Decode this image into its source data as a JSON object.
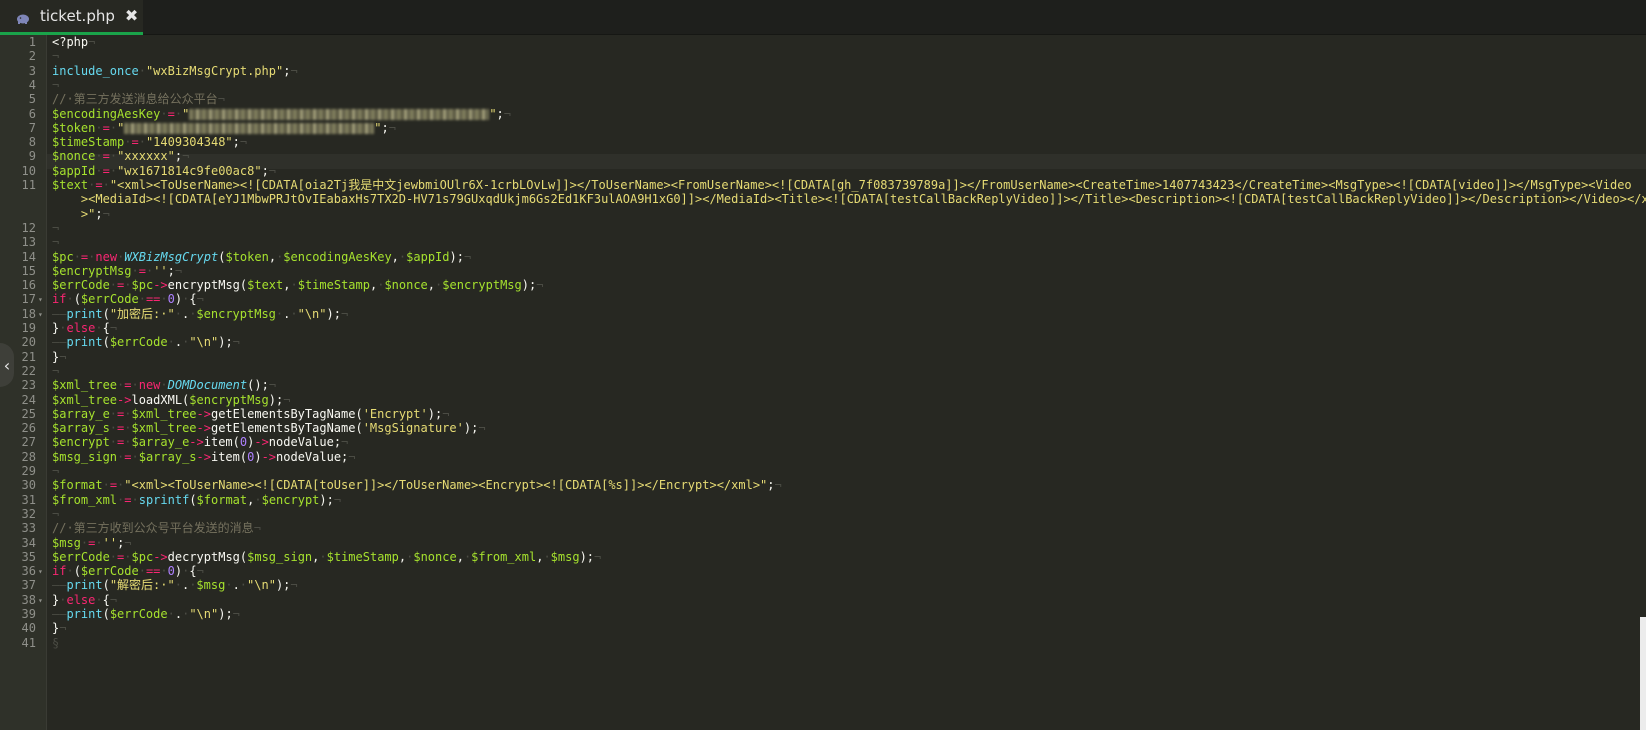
{
  "tab": {
    "title": "ticket.php",
    "close_glyph": "✖",
    "icon": "php-elephant-icon"
  },
  "handle": {
    "glyph": "‹"
  },
  "colors": {
    "background": "#272822",
    "gutter": "#2f3129",
    "variable": "#a6e22e",
    "string": "#e6db74",
    "comment": "#75715e",
    "keyword": "#f92672",
    "class": "#66d9ef",
    "number": "#ae81ff",
    "tab_accent": "#1aa34a"
  },
  "fold_lines": [
    17,
    18,
    36,
    38
  ],
  "active_line": 9,
  "lines": [
    [
      [
        "",
        "<?php"
      ],
      [
        "invis",
        "¬"
      ]
    ],
    [
      [
        "invis",
        "¬"
      ]
    ],
    [
      [
        "fn",
        "include_once"
      ],
      [
        "invis",
        "·"
      ],
      [
        "s",
        "\"wxBizMsgCrypt.php\""
      ],
      [
        "",
        ";"
      ],
      [
        "invis",
        "¬"
      ]
    ],
    [
      [
        "invis",
        "¬"
      ]
    ],
    [
      [
        "c",
        "//·第三方发送消息给公众平台"
      ],
      [
        "invis",
        "¬"
      ]
    ],
    [
      [
        "v",
        "$encodingAesKey"
      ],
      [
        "invis",
        "·"
      ],
      [
        "k",
        "="
      ],
      [
        "invis",
        "·"
      ],
      [
        "s",
        "\""
      ],
      [
        "blur",
        300
      ],
      [
        "s",
        "\""
      ],
      [
        "",
        ";"
      ],
      [
        "invis",
        "¬"
      ]
    ],
    [
      [
        "v",
        "$token"
      ],
      [
        "invis",
        "·"
      ],
      [
        "k",
        "="
      ],
      [
        "invis",
        "·"
      ],
      [
        "s",
        "\""
      ],
      [
        "blur",
        250
      ],
      [
        "s",
        "\""
      ],
      [
        "",
        ";"
      ],
      [
        "invis",
        "¬"
      ]
    ],
    [
      [
        "v",
        "$timeStamp"
      ],
      [
        "invis",
        "·"
      ],
      [
        "k",
        "="
      ],
      [
        "invis",
        "·"
      ],
      [
        "s",
        "\"1409304348\""
      ],
      [
        "",
        ";"
      ],
      [
        "invis",
        "¬"
      ]
    ],
    [
      [
        "v",
        "$nonce"
      ],
      [
        "invis",
        "·"
      ],
      [
        "k",
        "="
      ],
      [
        "invis",
        "·"
      ],
      [
        "s",
        "\"xxxxxx\""
      ],
      [
        "",
        ";"
      ],
      [
        "invis",
        "¬"
      ]
    ],
    [
      [
        "v",
        "$appId"
      ],
      [
        "invis",
        "·"
      ],
      [
        "k",
        "="
      ],
      [
        "invis",
        "·"
      ],
      [
        "s",
        "\"wx1671814c9fe00ac8\""
      ],
      [
        "",
        ";"
      ],
      [
        "invis",
        "¬"
      ]
    ],
    [
      [
        "v",
        "$text"
      ],
      [
        "invis",
        "·"
      ],
      [
        "k",
        "="
      ],
      [
        "invis",
        "·"
      ],
      [
        "s",
        "\"<xml><ToUserName><![CDATA[oia2Tj我是中文jewbmiOUlr6X-1crbLOvLw]]></ToUserName><FromUserName><![CDATA[gh_7f083739789a]]></FromUserName><CreateTime>1407743423</CreateTime><MsgType><![CDATA[video]]></MsgType><Video"
      ]
    ],
    [
      [
        "s",
        "    ><MediaId><![CDATA[eYJ1MbwPRJtOvIEabaxHs7TX2D-HV71s79GUxqdUkjm6Gs2Ed1KF3ulAOA9H1xG0]]></MediaId><Title><![CDATA[testCallBackReplyVideo]]></Title><Description><![CDATA[testCallBackReplyVideo]]></Description></Video></x"
      ]
    ],
    [
      [
        "s",
        "    >\""
      ],
      [
        "",
        ";"
      ],
      [
        "invis",
        "¬"
      ]
    ],
    [
      [
        "invis",
        "¬"
      ]
    ],
    [
      [
        "invis",
        "¬"
      ]
    ],
    [
      [
        "v",
        "$pc"
      ],
      [
        "invis",
        "·"
      ],
      [
        "k",
        "="
      ],
      [
        "invis",
        "·"
      ],
      [
        "k",
        "new"
      ],
      [
        "invis",
        "·"
      ],
      [
        "cls",
        "WXBizMsgCrypt"
      ],
      [
        "",
        "("
      ],
      [
        "v",
        "$token"
      ],
      [
        "",
        ","
      ],
      [
        "invis",
        "·"
      ],
      [
        "v",
        "$encodingAesKey"
      ],
      [
        "",
        ","
      ],
      [
        "invis",
        "·"
      ],
      [
        "v",
        "$appId"
      ],
      [
        "",
        ");"
      ],
      [
        "invis",
        "¬"
      ]
    ],
    [
      [
        "v",
        "$encryptMsg"
      ],
      [
        "invis",
        "·"
      ],
      [
        "k",
        "="
      ],
      [
        "invis",
        "·"
      ],
      [
        "s",
        "''"
      ],
      [
        "",
        ";"
      ],
      [
        "invis",
        "¬"
      ]
    ],
    [
      [
        "v",
        "$errCode"
      ],
      [
        "invis",
        "·"
      ],
      [
        "k",
        "="
      ],
      [
        "invis",
        "·"
      ],
      [
        "v",
        "$pc"
      ],
      [
        "k",
        "->"
      ],
      [
        "",
        "encryptMsg("
      ],
      [
        "v",
        "$text"
      ],
      [
        "",
        ","
      ],
      [
        "invis",
        "·"
      ],
      [
        "v",
        "$timeStamp"
      ],
      [
        "",
        ","
      ],
      [
        "invis",
        "·"
      ],
      [
        "v",
        "$nonce"
      ],
      [
        "",
        ","
      ],
      [
        "invis",
        "·"
      ],
      [
        "v",
        "$encryptMsg"
      ],
      [
        "",
        ");"
      ],
      [
        "invis",
        "¬"
      ]
    ],
    [
      [
        "k",
        "if"
      ],
      [
        "invis",
        "·"
      ],
      [
        "",
        "("
      ],
      [
        "v",
        "$errCode"
      ],
      [
        "invis",
        "·"
      ],
      [
        "k",
        "=="
      ],
      [
        "invis",
        "·"
      ],
      [
        "n",
        "0"
      ],
      [
        "",
        ")"
      ],
      [
        "invis",
        "·"
      ],
      [
        "",
        "{"
      ],
      [
        "invis",
        "¬"
      ]
    ],
    [
      [
        "invis",
        "——"
      ],
      [
        "fn",
        "print"
      ],
      [
        "",
        "("
      ],
      [
        "s",
        "\"加密后:·\""
      ],
      [
        "invis",
        "·"
      ],
      [
        "",
        "."
      ],
      [
        "invis",
        "·"
      ],
      [
        "v",
        "$encryptMsg"
      ],
      [
        "invis",
        "·"
      ],
      [
        "",
        "."
      ],
      [
        "invis",
        "·"
      ],
      [
        "s",
        "\"\\n\""
      ],
      [
        "",
        ");"
      ],
      [
        "invis",
        "¬"
      ]
    ],
    [
      [
        "",
        "}"
      ],
      [
        "invis",
        "·"
      ],
      [
        "k",
        "else"
      ],
      [
        "invis",
        "·"
      ],
      [
        "",
        "{"
      ],
      [
        "invis",
        "¬"
      ]
    ],
    [
      [
        "invis",
        "——"
      ],
      [
        "fn",
        "print"
      ],
      [
        "",
        "("
      ],
      [
        "v",
        "$errCode"
      ],
      [
        "invis",
        "·"
      ],
      [
        "",
        "."
      ],
      [
        "invis",
        "·"
      ],
      [
        "s",
        "\"\\n\""
      ],
      [
        "",
        ");"
      ],
      [
        "invis",
        "¬"
      ]
    ],
    [
      [
        "",
        "}"
      ],
      [
        "invis",
        "¬"
      ]
    ],
    [
      [
        "invis",
        "¬"
      ]
    ],
    [
      [
        "v",
        "$xml_tree"
      ],
      [
        "invis",
        "·"
      ],
      [
        "k",
        "="
      ],
      [
        "invis",
        "·"
      ],
      [
        "k",
        "new"
      ],
      [
        "invis",
        "·"
      ],
      [
        "cls",
        "DOMDocument"
      ],
      [
        "",
        "();"
      ],
      [
        "invis",
        "¬"
      ]
    ],
    [
      [
        "v",
        "$xml_tree"
      ],
      [
        "k",
        "->"
      ],
      [
        "",
        "loadXML("
      ],
      [
        "v",
        "$encryptMsg"
      ],
      [
        "",
        ");"
      ],
      [
        "invis",
        "¬"
      ]
    ],
    [
      [
        "v",
        "$array_e"
      ],
      [
        "invis",
        "·"
      ],
      [
        "k",
        "="
      ],
      [
        "invis",
        "·"
      ],
      [
        "v",
        "$xml_tree"
      ],
      [
        "k",
        "->"
      ],
      [
        "",
        "getElementsByTagName("
      ],
      [
        "s",
        "'Encrypt'"
      ],
      [
        "",
        ");"
      ],
      [
        "invis",
        "¬"
      ]
    ],
    [
      [
        "v",
        "$array_s"
      ],
      [
        "invis",
        "·"
      ],
      [
        "k",
        "="
      ],
      [
        "invis",
        "·"
      ],
      [
        "v",
        "$xml_tree"
      ],
      [
        "k",
        "->"
      ],
      [
        "",
        "getElementsByTagName("
      ],
      [
        "s",
        "'MsgSignature'"
      ],
      [
        "",
        ");"
      ],
      [
        "invis",
        "¬"
      ]
    ],
    [
      [
        "v",
        "$encrypt"
      ],
      [
        "invis",
        "·"
      ],
      [
        "k",
        "="
      ],
      [
        "invis",
        "·"
      ],
      [
        "v",
        "$array_e"
      ],
      [
        "k",
        "->"
      ],
      [
        "",
        "item("
      ],
      [
        "n",
        "0"
      ],
      [
        "",
        ")"
      ],
      [
        "k",
        "->"
      ],
      [
        "",
        "nodeValue;"
      ],
      [
        "invis",
        "¬"
      ]
    ],
    [
      [
        "v",
        "$msg_sign"
      ],
      [
        "invis",
        "·"
      ],
      [
        "k",
        "="
      ],
      [
        "invis",
        "·"
      ],
      [
        "v",
        "$array_s"
      ],
      [
        "k",
        "->"
      ],
      [
        "",
        "item("
      ],
      [
        "n",
        "0"
      ],
      [
        "",
        ")"
      ],
      [
        "k",
        "->"
      ],
      [
        "",
        "nodeValue;"
      ],
      [
        "invis",
        "¬"
      ]
    ],
    [
      [
        "invis",
        "¬"
      ]
    ],
    [
      [
        "v",
        "$format"
      ],
      [
        "invis",
        "·"
      ],
      [
        "k",
        "="
      ],
      [
        "invis",
        "·"
      ],
      [
        "s",
        "\"<xml><ToUserName><![CDATA[toUser]]></ToUserName><Encrypt><![CDATA[%s]]></Encrypt></xml>\""
      ],
      [
        "",
        ";"
      ],
      [
        "invis",
        "¬"
      ]
    ],
    [
      [
        "v",
        "$from_xml"
      ],
      [
        "invis",
        "·"
      ],
      [
        "k",
        "="
      ],
      [
        "invis",
        "·"
      ],
      [
        "fn",
        "sprintf"
      ],
      [
        "",
        "("
      ],
      [
        "v",
        "$format"
      ],
      [
        "",
        ","
      ],
      [
        "invis",
        "·"
      ],
      [
        "v",
        "$encrypt"
      ],
      [
        "",
        ");"
      ],
      [
        "invis",
        "¬"
      ]
    ],
    [
      [
        "invis",
        "¬"
      ]
    ],
    [
      [
        "c",
        "//·第三方收到公众号平台发送的消息"
      ],
      [
        "invis",
        "¬"
      ]
    ],
    [
      [
        "v",
        "$msg"
      ],
      [
        "invis",
        "·"
      ],
      [
        "k",
        "="
      ],
      [
        "invis",
        "·"
      ],
      [
        "s",
        "''"
      ],
      [
        "",
        ";"
      ],
      [
        "invis",
        "¬"
      ]
    ],
    [
      [
        "v",
        "$errCode"
      ],
      [
        "invis",
        "·"
      ],
      [
        "k",
        "="
      ],
      [
        "invis",
        "·"
      ],
      [
        "v",
        "$pc"
      ],
      [
        "k",
        "->"
      ],
      [
        "",
        "decryptMsg("
      ],
      [
        "v",
        "$msg_sign"
      ],
      [
        "",
        ","
      ],
      [
        "invis",
        "·"
      ],
      [
        "v",
        "$timeStamp"
      ],
      [
        "",
        ","
      ],
      [
        "invis",
        "·"
      ],
      [
        "v",
        "$nonce"
      ],
      [
        "",
        ","
      ],
      [
        "invis",
        "·"
      ],
      [
        "v",
        "$from_xml"
      ],
      [
        "",
        ","
      ],
      [
        "invis",
        "·"
      ],
      [
        "v",
        "$msg"
      ],
      [
        "",
        ");"
      ],
      [
        "invis",
        "¬"
      ]
    ],
    [
      [
        "k",
        "if"
      ],
      [
        "invis",
        "·"
      ],
      [
        "",
        "("
      ],
      [
        "v",
        "$errCode"
      ],
      [
        "invis",
        "·"
      ],
      [
        "k",
        "=="
      ],
      [
        "invis",
        "·"
      ],
      [
        "n",
        "0"
      ],
      [
        "",
        ")"
      ],
      [
        "invis",
        "·"
      ],
      [
        "",
        "{"
      ],
      [
        "invis",
        "¬"
      ]
    ],
    [
      [
        "invis",
        "——"
      ],
      [
        "fn",
        "print"
      ],
      [
        "",
        "("
      ],
      [
        "s",
        "\"解密后:·\""
      ],
      [
        "invis",
        "·"
      ],
      [
        "",
        "."
      ],
      [
        "invis",
        "·"
      ],
      [
        "v",
        "$msg"
      ],
      [
        "invis",
        "·"
      ],
      [
        "",
        "."
      ],
      [
        "invis",
        "·"
      ],
      [
        "s",
        "\"\\n\""
      ],
      [
        "",
        ");"
      ],
      [
        "invis",
        "¬"
      ]
    ],
    [
      [
        "",
        "}"
      ],
      [
        "invis",
        "·"
      ],
      [
        "k",
        "else"
      ],
      [
        "invis",
        "·"
      ],
      [
        "",
        "{"
      ],
      [
        "invis",
        "¬"
      ]
    ],
    [
      [
        "invis",
        "——"
      ],
      [
        "fn",
        "print"
      ],
      [
        "",
        "("
      ],
      [
        "v",
        "$errCode"
      ],
      [
        "invis",
        "·"
      ],
      [
        "",
        "."
      ],
      [
        "invis",
        "·"
      ],
      [
        "s",
        "\"\\n\""
      ],
      [
        "",
        ");"
      ],
      [
        "invis",
        "¬"
      ]
    ],
    [
      [
        "",
        "}"
      ],
      [
        "invis",
        "¬"
      ]
    ],
    [
      [
        "invis",
        "§"
      ]
    ]
  ],
  "line_numbers": [
    "1",
    "2",
    "3",
    "4",
    "5",
    "6",
    "7",
    "8",
    "9",
    "10",
    "11",
    "",
    "",
    "12",
    "13",
    "14",
    "15",
    "16",
    "17",
    "18",
    "19",
    "20",
    "21",
    "22",
    "23",
    "24",
    "25",
    "26",
    "27",
    "28",
    "29",
    "30",
    "31",
    "32",
    "33",
    "34",
    "35",
    "36",
    "37",
    "38",
    "39",
    "40",
    "41"
  ]
}
